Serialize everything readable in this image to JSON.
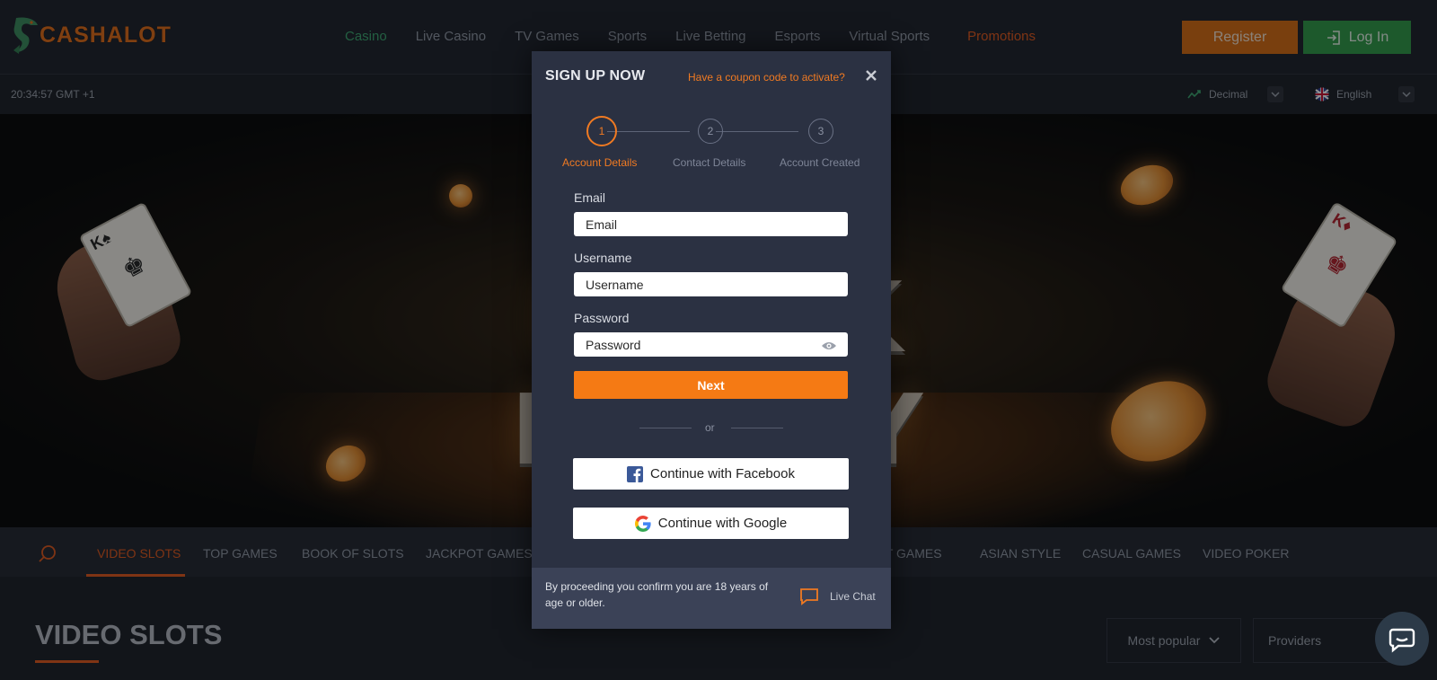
{
  "brand": {
    "name": "CASHALOT"
  },
  "nav": {
    "items": [
      "Casino",
      "Live Casino",
      "TV Games",
      "Sports",
      "Live Betting",
      "Esports",
      "Virtual Sports"
    ],
    "promotions": "Promotions",
    "register": "Register",
    "login": "Log In"
  },
  "subbar": {
    "clock": "20:34:57 GMT +1",
    "odds_format": "Decimal",
    "language": "English"
  },
  "hero": {
    "title": "BLACK FRIDAY"
  },
  "categories": {
    "items": [
      "VIDEO SLOTS",
      "TOP GAMES",
      "BOOK OF SLOTS",
      "JACKPOT GAMES",
      "RT GAMES",
      "ASIAN STYLE",
      "CASUAL GAMES",
      "VIDEO POKER"
    ],
    "active": "VIDEO SLOTS"
  },
  "section": {
    "title": "VIDEO SLOTS",
    "sort": "Most popular",
    "providers": "Providers"
  },
  "modal": {
    "title": "SIGN UP NOW",
    "coupon_link": "Have a coupon code to activate?",
    "steps": [
      {
        "number": "1",
        "label": "Account Details"
      },
      {
        "number": "2",
        "label": "Contact Details"
      },
      {
        "number": "3",
        "label": "Account Created"
      }
    ],
    "active_step": 1,
    "fields": {
      "email": {
        "label": "Email",
        "placeholder": "Email"
      },
      "username": {
        "label": "Username",
        "placeholder": "Username"
      },
      "password": {
        "label": "Password",
        "placeholder": "Password"
      }
    },
    "next_button": "Next",
    "or_text": "or",
    "facebook_button": "Continue with Facebook",
    "google_button": "Continue with Google",
    "footer_text": "By proceeding you confirm you are 18 years of age or older.",
    "live_chat": "Live Chat"
  },
  "colors": {
    "accent": "#f57a14",
    "active_nav": "#3aa56d",
    "login_green": "#2f9a45",
    "modal_bg": "#2b3142",
    "page_bg": "#1b1e26"
  },
  "icons": [
    "logo-fish-icon",
    "login-arrow-icon",
    "odds-chart-icon",
    "chevron-down-icon",
    "uk-flag-icon",
    "close-icon",
    "eye-icon",
    "facebook-icon",
    "google-icon",
    "chat-icon",
    "search-icon",
    "filter-icon",
    "support-chat-icon"
  ]
}
